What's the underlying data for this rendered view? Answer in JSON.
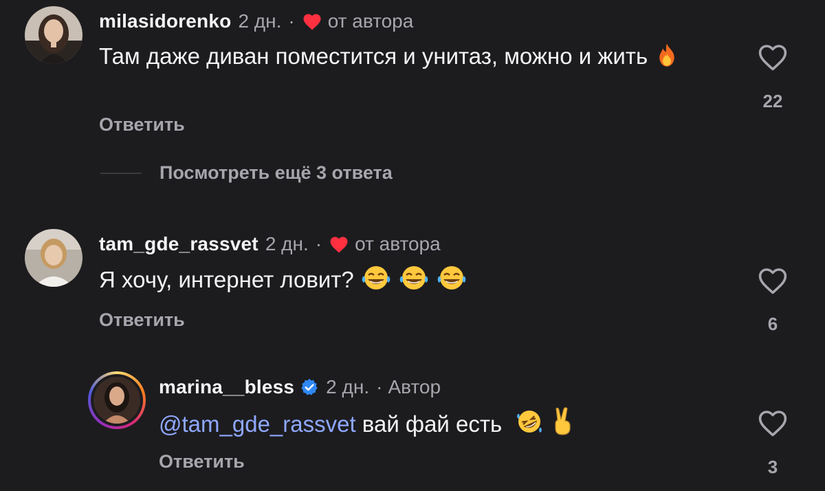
{
  "comments": [
    {
      "username": "milasidorenko",
      "time": "2 дн.",
      "separator": "·",
      "author_liked_label": "от автора",
      "text": "Там даже диван поместится и унитаз, можно и жить",
      "emoji": "fire",
      "reply_label": "Ответить",
      "likes": "22"
    },
    {
      "username": "tam_gde_rassvet",
      "time": "2 дн.",
      "separator": "·",
      "author_liked_label": "от автора",
      "text": "Я хочу, интернет ловит?",
      "emoji": "face-with-tears-of-joy ×3",
      "reply_label": "Ответить",
      "likes": "6"
    }
  ],
  "more_replies": {
    "label": "Посмотреть ещё 3 ответа"
  },
  "reply": {
    "username": "marina__bless",
    "verified": true,
    "time": "2 дн.",
    "separator": "·",
    "author_badge": "Автор",
    "mention": "@tam_gde_rassvet",
    "text": " вай фай есть ",
    "emoji": "rolling-on-floor-laughing, victory-hand",
    "reply_label": "Ответить",
    "likes": "3"
  },
  "colors": {
    "background": "#1c1c1f",
    "text": "#f4f4f5",
    "muted": "#a6a6ad",
    "heart_red": "#ff3040",
    "mention": "#8fa8ff",
    "verified_blue": "#2f88f6"
  }
}
